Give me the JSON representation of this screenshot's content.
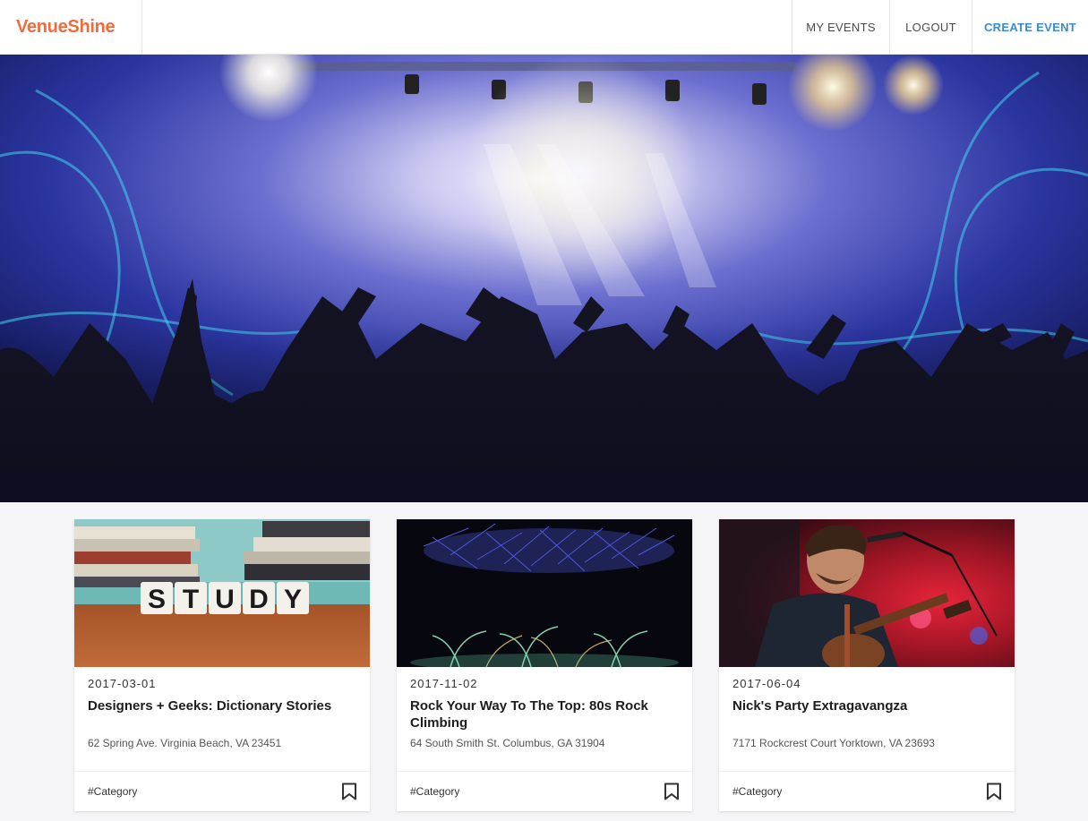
{
  "app": {
    "brand": "VenueShine",
    "brand_color": "#f26b3a",
    "accent_color": "#3b8bd0"
  },
  "nav": {
    "my_events": "MY EVENTS",
    "logout": "LOGOUT",
    "create_event": "CREATE EVENT"
  },
  "hero": {
    "image": "concert-crowd-stage-lights"
  },
  "events": [
    {
      "date": "2017-03-01",
      "title": "Designers + Geeks: Dictionary Stories",
      "address": "62 Spring Ave. Virginia Beach, VA 23451",
      "category": "#Category",
      "image": "study-letter-blocks-books",
      "image_text": "STUDY",
      "icon": "bookmark-icon"
    },
    {
      "date": "2017-11-02",
      "title": "Rock Your Way To The Top: 80s Rock Climbing",
      "address": "64 South Smith St. Columbus, GA 31904",
      "category": "#Category",
      "image": "fireworks-night-sky",
      "icon": "bookmark-icon"
    },
    {
      "date": "2017-06-04",
      "title": "Nick's Party Extragavangza",
      "address": "7171 Rockcrest Court Yorktown, VA 23693",
      "category": "#Category",
      "image": "singer-with-guitar-red-light",
      "icon": "bookmark-icon"
    }
  ]
}
